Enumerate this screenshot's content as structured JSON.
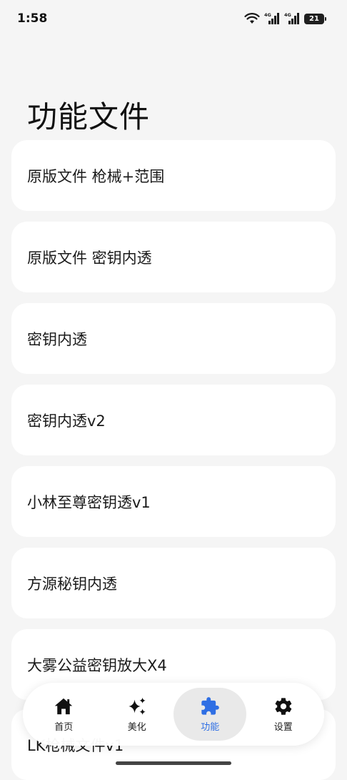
{
  "status_bar": {
    "time": "1:58",
    "battery": "21",
    "signal_label": "4G"
  },
  "page": {
    "title": "功能文件"
  },
  "items": [
    {
      "label": "原版文件 枪械+范围"
    },
    {
      "label": "原版文件 密钥内透"
    },
    {
      "label": "密钥内透"
    },
    {
      "label": "密钥内透v2"
    },
    {
      "label": "小林至尊密钥透v1"
    },
    {
      "label": "方源秘钥内透"
    },
    {
      "label": "大雾公益密钥放大X4"
    },
    {
      "label": "LK枪械文件v1"
    }
  ],
  "nav": {
    "active_color": "#2f6fe4",
    "items": [
      {
        "label": "首页",
        "icon": "home-icon"
      },
      {
        "label": "美化",
        "icon": "sparkle-icon"
      },
      {
        "label": "功能",
        "icon": "puzzle-icon"
      },
      {
        "label": "设置",
        "icon": "gear-icon"
      }
    ]
  }
}
